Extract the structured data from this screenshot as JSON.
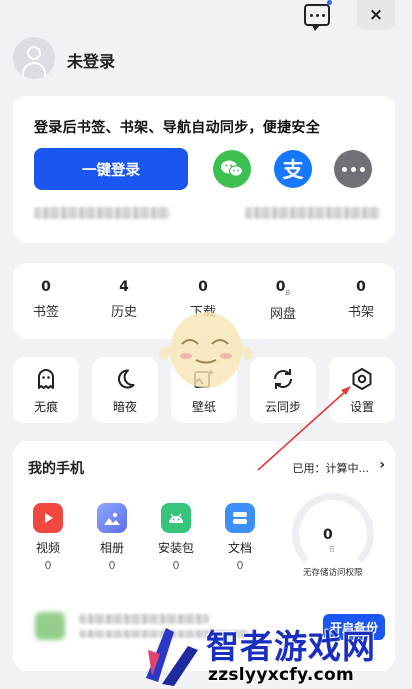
{
  "top_bar": {
    "message_icon": "message-bubble-icon",
    "close_label": "×"
  },
  "user": {
    "avatar_icon": "user-avatar-icon",
    "name": "未登录"
  },
  "login_card": {
    "tip": "登录后书签、书架、导航自动同步，便捷安全",
    "login_button": "一键登录",
    "alt_logins": [
      {
        "icon": "wechat-icon",
        "color": "#3cc04f"
      },
      {
        "icon": "alipay-icon",
        "glyph": "支",
        "color": "#1677ff"
      },
      {
        "icon": "more-options-icon",
        "color": "#6f7177"
      }
    ]
  },
  "stats": [
    {
      "value": "0",
      "label": "书签"
    },
    {
      "value": "4",
      "label": "历史"
    },
    {
      "value": "0",
      "label": "下载"
    },
    {
      "value": "0",
      "unit": "B",
      "label": "网盘"
    },
    {
      "value": "0",
      "label": "书架"
    }
  ],
  "tiles": [
    {
      "label": "无痕",
      "icon": "ghost-icon"
    },
    {
      "label": "暗夜",
      "icon": "moon-icon"
    },
    {
      "label": "壁纸",
      "icon": "wallpaper-icon"
    },
    {
      "label": "云同步",
      "icon": "sync-icon"
    },
    {
      "label": "设置",
      "icon": "settings-hexagon-icon"
    }
  ],
  "phone": {
    "title": "我的手机",
    "used_label": "已用：计算中...",
    "apps": [
      {
        "label": "视频",
        "count": "0",
        "icon": "video-icon",
        "color": "#f0483e"
      },
      {
        "label": "相册",
        "count": "0",
        "icon": "album-icon",
        "color": "#6a86f2"
      },
      {
        "label": "安装包",
        "count": "0",
        "icon": "android-apk-icon",
        "color": "#35c47a"
      },
      {
        "label": "文档",
        "count": "0",
        "icon": "document-icon",
        "color": "#3b8ff6"
      }
    ],
    "storage": {
      "value": "0",
      "unit": "B",
      "label": "无存储访问权限"
    },
    "backup_button": "开启备份"
  },
  "watermark": {
    "title": "智者游戏网",
    "url": "zzslyyxcfy.com"
  },
  "colors": {
    "accent": "#1a56f0",
    "background": "#f1f2f6",
    "annotation": "#e23a3a"
  }
}
